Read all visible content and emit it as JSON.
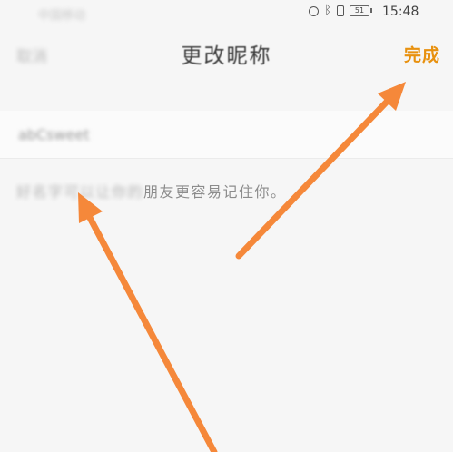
{
  "status_bar": {
    "carrier": "中国移动",
    "battery": "51",
    "time": "15:48"
  },
  "header": {
    "back_label": "取消",
    "title": "更改昵称",
    "done_label": "完成"
  },
  "nickname": {
    "value": "abCsweet"
  },
  "hint": {
    "obscured": "好名字可以让你的",
    "visible": "朋友更容易记住你。"
  },
  "colors": {
    "accent": "#e8910f",
    "arrow": "#f5883a",
    "background": "#f6f6f6"
  },
  "icons": [
    "alarm-icon",
    "bluetooth-icon",
    "vibrate-icon",
    "battery-icon",
    "arrow-icon"
  ]
}
